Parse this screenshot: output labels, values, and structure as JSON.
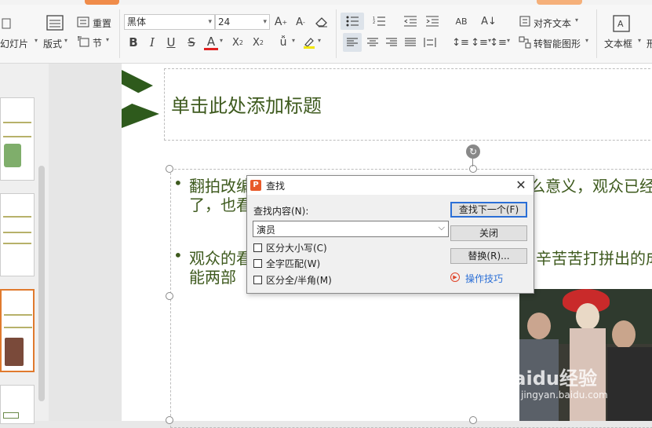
{
  "ribbon": {
    "slide_partial_label": "幻灯片",
    "layout_label": "版式",
    "reset_label": "重置",
    "section_label": "节",
    "font_name": "黑体",
    "font_size": "24",
    "align_text_label": "对齐文本",
    "smartart_label": "转智能图形",
    "textbox_label": "文本框",
    "cut_partial_label": "形"
  },
  "slide": {
    "title_placeholder": "单击此处添加标题",
    "bullet1_line1": "翻拍改编",
    "bullet1_line1_right": "么意义，观众已经",
    "bullet1_line2": "了，也看",
    "bullet2_line1": "观众的看",
    "bullet2_line1_right": "辛苦苦打拼出的成",
    "bullet2_line2": "能两部",
    "accent_color": "#2e5a1c",
    "text_color": "#3e5a1e"
  },
  "dialog": {
    "title": "查找",
    "find_label": "查找内容(N):",
    "find_value": "演员",
    "option_case": "区分大小写(C)",
    "option_whole": "全字匹配(W)",
    "option_width": "区分全/半角(M)",
    "btn_find_next": "查找下一个(F)",
    "btn_close": "关闭",
    "btn_replace": "替换(R)...",
    "tips_link": "操作技巧"
  },
  "watermark": {
    "brand": "Baidu经验",
    "url": "jingyan.baidu.com"
  }
}
